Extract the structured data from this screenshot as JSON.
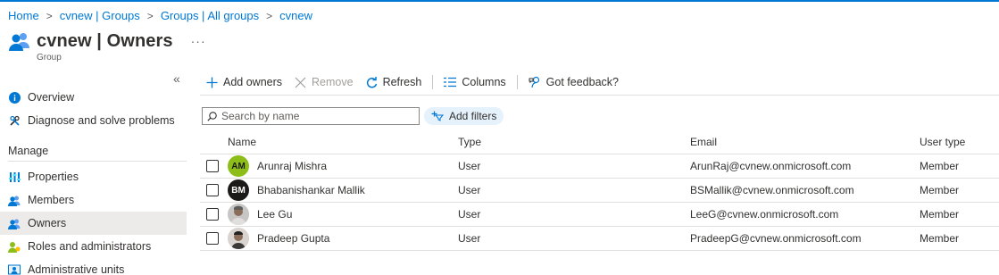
{
  "breadcrumb": {
    "items": [
      "Home",
      "cvnew | Groups",
      "Groups | All groups",
      "cvnew"
    ],
    "separator": ">"
  },
  "header": {
    "title": "cvnew | Owners",
    "more": "···",
    "subtitle": "Group"
  },
  "sidebar": {
    "collapse": "«",
    "items_top": [
      {
        "label": "Overview",
        "icon": "info-icon"
      },
      {
        "label": "Diagnose and solve problems",
        "icon": "wrench-icon"
      }
    ],
    "section_header": "Manage",
    "items_manage": [
      {
        "label": "Properties",
        "icon": "properties-icon"
      },
      {
        "label": "Members",
        "icon": "members-icon"
      },
      {
        "label": "Owners",
        "icon": "owners-icon",
        "active": true
      },
      {
        "label": "Roles and administrators",
        "icon": "roles-icon"
      },
      {
        "label": "Administrative units",
        "icon": "admin-units-icon"
      }
    ]
  },
  "toolbar": {
    "add_owners": "Add owners",
    "remove": "Remove",
    "refresh": "Refresh",
    "columns": "Columns",
    "feedback": "Got feedback?"
  },
  "search": {
    "placeholder": "Search by name",
    "value": ""
  },
  "filters": {
    "add_filters": "Add filters"
  },
  "table": {
    "headers": [
      "Name",
      "Type",
      "Email",
      "User type"
    ],
    "rows": [
      {
        "initials": "AM",
        "avatar_color": "#8cbd18",
        "name": "Arunraj Mishra",
        "type": "User",
        "email": "ArunRaj@cvnew.onmicrosoft.com",
        "user_type": "Member"
      },
      {
        "initials": "BM",
        "avatar_color": "#1b1a19",
        "name": "Bhabanishankar Mallik",
        "type": "User",
        "email": "BSMallik@cvnew.onmicrosoft.com",
        "user_type": "Member"
      },
      {
        "initials": "",
        "avatar_color": "#b5b3b0",
        "name": "Lee Gu",
        "type": "User",
        "email": "LeeG@cvnew.onmicrosoft.com",
        "user_type": "Member"
      },
      {
        "initials": "",
        "avatar_color": "#8a6e5a",
        "name": "Pradeep Gupta",
        "type": "User",
        "email": "PradeepG@cvnew.onmicrosoft.com",
        "user_type": "Member"
      }
    ]
  },
  "colors": {
    "accent": "#0078d4",
    "active_nav": "#edebe9",
    "pill": "#e5f1fb"
  }
}
